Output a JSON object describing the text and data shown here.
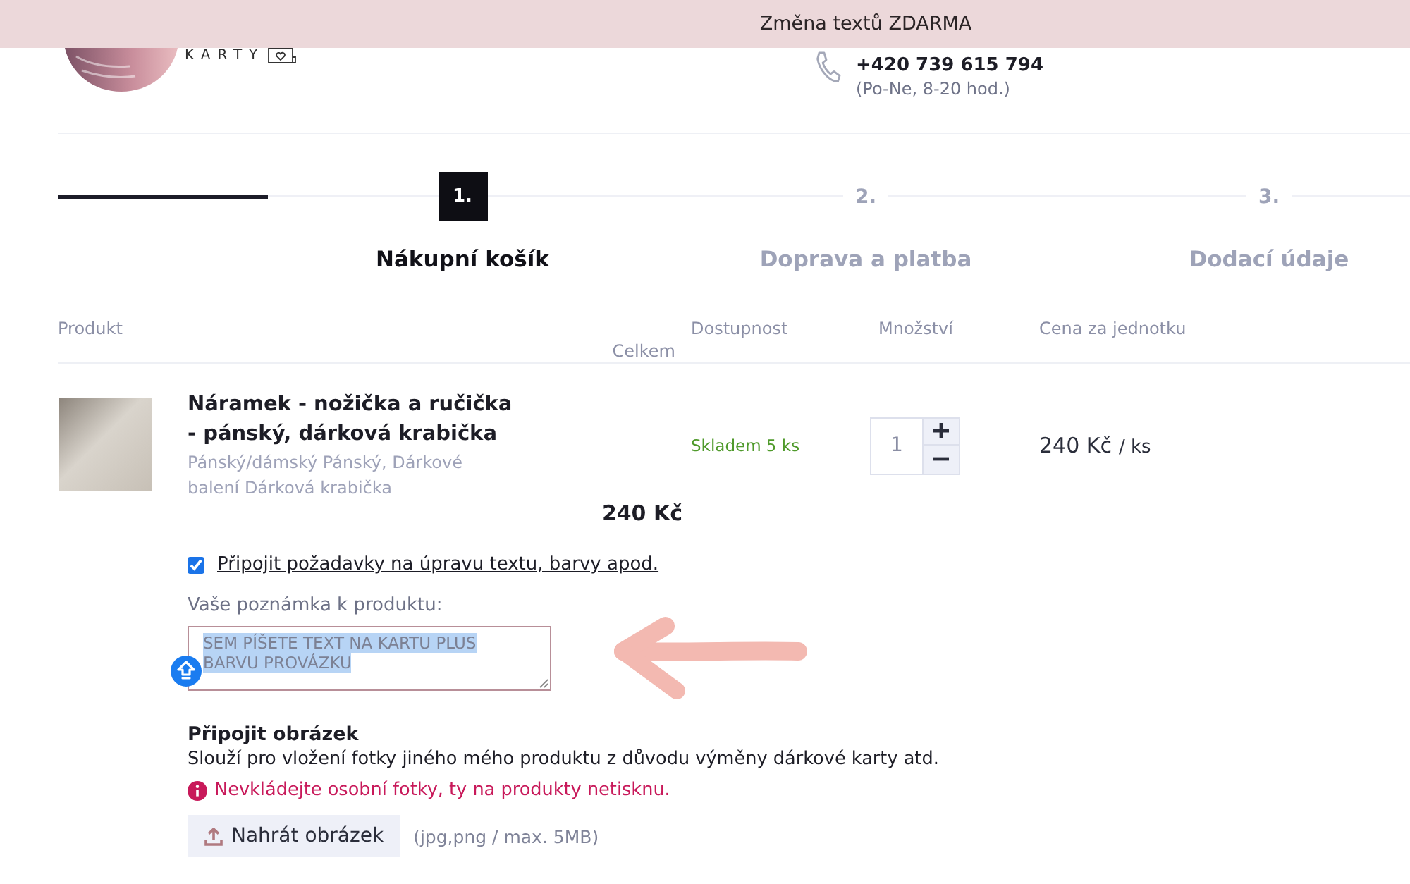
{
  "banner": {
    "text": "Změna textů ZDARMA"
  },
  "header": {
    "logo_text": "KARTY",
    "phone": "+420 739 615 794",
    "hours": "(Po-Ne, 8-20 hod.)"
  },
  "stepper": {
    "level": 0.155,
    "steps": [
      {
        "number": "1.",
        "label": "Nákupní košík",
        "selected": true
      },
      {
        "number": "2.",
        "label": "Doprava a platba",
        "selected": false
      },
      {
        "number": "3.",
        "label": "Dodací údaje",
        "selected": false
      }
    ]
  },
  "cart": {
    "columns": [
      "Produkt",
      "Dostupnost",
      "Množství",
      "Cena za jednotku",
      "Celkem"
    ],
    "items": [
      {
        "name": "Náramek - nožička a ručička - pánský, dárková krabička",
        "variant": "Pánský/dámský Pánský, Dárkové balení Dárková krabička",
        "availability": "Skladem 5 ks",
        "quantity": "1",
        "unit_price": "240 Kč",
        "unit": "/ ks",
        "total": "240 Kč",
        "customization": {
          "label": "Připojit požadavky na úpravu textu, barvy apod.",
          "checked": true
        },
        "note": {
          "label": "Vaše poznámka k produktu:",
          "value": "SEM PÍŠETE TEXT NA KARTU PLUS BARVU PROVÁZKU",
          "highlighted": true
        },
        "attachment": {
          "title": "Připojit obrázek",
          "description": "Slouží pro vložení fotky jiného mého produktu z důvodu výměny dárkové karty atd.",
          "warning": "Nevkládejte osobní fotky, ty na produkty netisknu.",
          "button": "Nahrát obrázek",
          "hint": "(jpg,png / max. 5MB)"
        }
      }
    ]
  }
}
